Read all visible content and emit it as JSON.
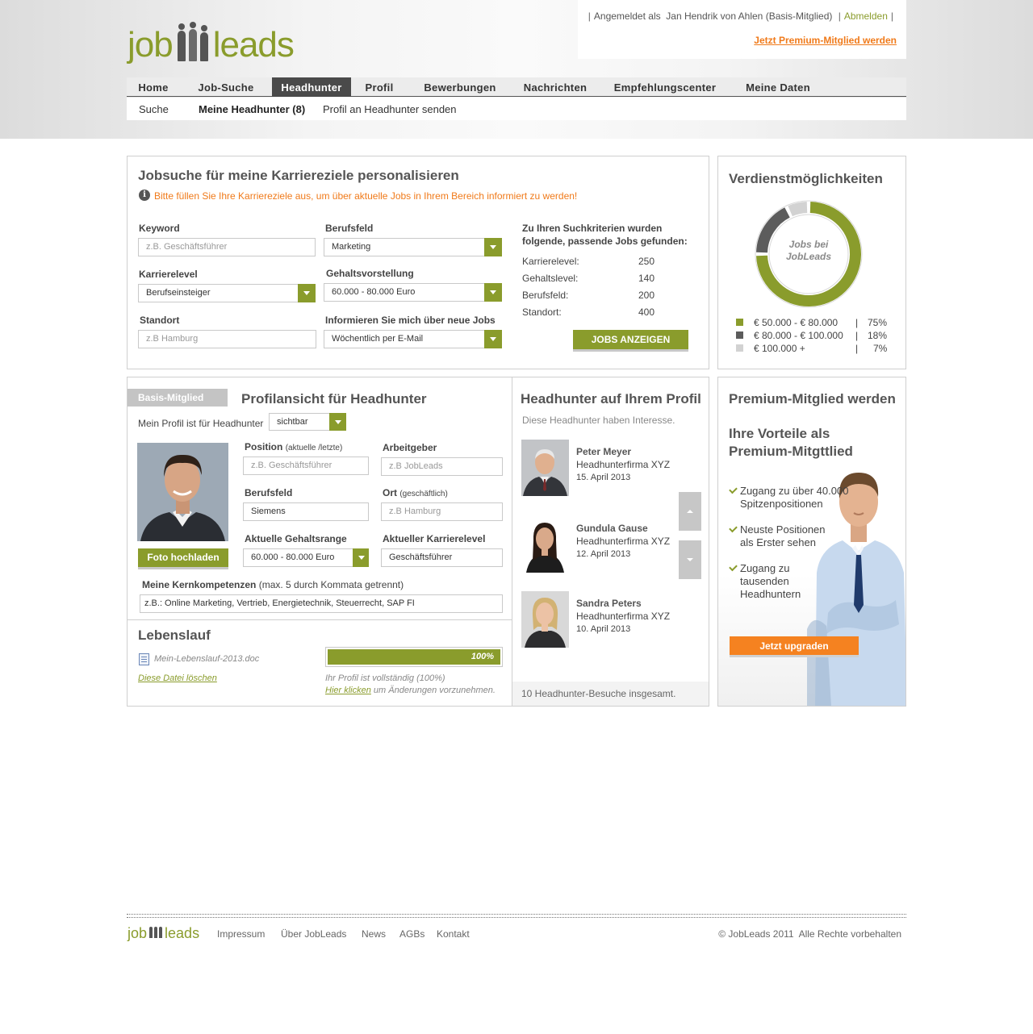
{
  "logo": {
    "part1": "job",
    "part2": "leads"
  },
  "user": {
    "prefix": "Angemeldet als",
    "name": "Jan Hendrik von Ahlen (Basis-Mitglied)",
    "logout": "Abmelden",
    "premium_link": "Jetzt Premium-Mitglied werden"
  },
  "nav": {
    "items": [
      "Home",
      "Job-Suche",
      "Headhunter",
      "Profil",
      "Bewerbungen",
      "Nachrichten",
      "Empfehlungscenter",
      "Meine Daten"
    ],
    "active": "Headhunter"
  },
  "subnav": {
    "items": [
      "Suche",
      "Meine Headhunter (8)",
      "Profil an Headhunter senden"
    ]
  },
  "jobsearch": {
    "title": "Jobsuche für meine Karriereziele personalisieren",
    "notice": "Bitte füllen Sie Ihre Karriereziele aus, um über aktuelle Jobs in Ihrem Bereich informiert zu werden!",
    "keyword_label": "Keyword",
    "keyword_placeholder": "z.B. Geschäftsführer",
    "berufsfeld_label": "Berufsfeld",
    "berufsfeld_value": "Marketing",
    "karrierelevel_label": "Karrierelevel",
    "karrierelevel_value": "Berufseinsteiger",
    "gehalt_label": "Gehaltsvorstellung",
    "gehalt_value": "60.000 - 80.000 Euro",
    "standort_label": "Standort",
    "standort_placeholder": "z.B Hamburg",
    "inform_label": "Informieren Sie mich über neue Jobs",
    "inform_value": "Wöchentlich per E-Mail",
    "results_title_1": "Zu Ihren Suchkriterien wurden",
    "results_title_2": "folgende, passende Jobs gefunden:",
    "results": [
      {
        "label": "Karrierelevel:",
        "value": "250"
      },
      {
        "label": "Gehaltslevel:",
        "value": "140"
      },
      {
        "label": "Berufsfeld:",
        "value": "200"
      },
      {
        "label": "Standort:",
        "value": "400"
      }
    ],
    "button": "JOBS ANZEIGEN"
  },
  "earnings": {
    "title": "Verdienstmöglichkeiten",
    "center_1": "Jobs bei",
    "center_2": "JobLeads",
    "legend": [
      {
        "range": "€ 50.000 - € 80.000",
        "sep": "|",
        "pct": "75%",
        "value": 75,
        "color": "#8a9c2c"
      },
      {
        "range": "€ 80.000 - € 100.000",
        "sep": "|",
        "pct": "18%",
        "value": 18,
        "color": "#5c5c5c"
      },
      {
        "range": "€ 100.000 +",
        "sep": "|",
        "pct": "7%",
        "value": 7,
        "color": "#d2d2d2"
      }
    ]
  },
  "profile": {
    "badge": "Basis-Mitglied",
    "title": "Profilansicht für Headhunter",
    "visibility_label": "Mein Profil ist für Headhunter",
    "visibility_value": "sichtbar",
    "photo_button": "Foto hochladen",
    "position_label": "Position",
    "position_note": "(aktuelle /letzte)",
    "position_placeholder": "z.B. Geschäftsführer",
    "arbeitgeber_label": "Arbeitgeber",
    "arbeitgeber_placeholder": "z.B JobLeads",
    "berufsfeld_label": "Berufsfeld",
    "berufsfeld_value": "Siemens",
    "ort_label": "Ort",
    "ort_note": "(geschäftlich)",
    "ort_placeholder": "z.B Hamburg",
    "gehalt_label": "Aktuelle Gehaltsrange",
    "gehalt_value": "60.000 - 80.000 Euro",
    "karriere_label": "Aktueller Karrierelevel",
    "karriere_value": "Geschäftsführer",
    "kern_label": "Meine Kernkompetenzen",
    "kern_note": "(max. 5 durch Kommata getrennt)",
    "kern_value": "z.B.: Online Marketing, Vertrieb, Energietechnik, Steuerrecht, SAP FI"
  },
  "cv": {
    "title": "Lebenslauf",
    "file": "Mein-Lebenslauf-2013.doc",
    "delete": "Diese Datei löschen",
    "progress_label": "100%",
    "progress": 100,
    "complete": "Ihr Profil ist vollständig (100%)",
    "click": "Hier klicken",
    "click_rest": "um Änderungen vorzunehmen."
  },
  "headhunters": {
    "title": "Headhunter auf Ihrem Profil",
    "subtitle": "Diese Headhunter haben Interesse.",
    "people": [
      {
        "name": "Peter Meyer",
        "firm": "Headhunterfirma XYZ",
        "date": "15. April 2013"
      },
      {
        "name": "Gundula Gause",
        "firm": "Headhunterfirma XYZ",
        "date": "12. April 2013"
      },
      {
        "name": "Sandra Peters",
        "firm": "Headhunterfirma XYZ",
        "date": "10. April 2013"
      }
    ],
    "footer": "10 Headhunter-Besuche insgesamt."
  },
  "premium": {
    "title": "Premium-Mitglied werden",
    "sub_1": "Ihre Vorteile als",
    "sub_2": "Premium-Mitgttlied",
    "benefits": [
      {
        "l1": "Zugang zu über 40.000",
        "l2": "Spitzenpositionen"
      },
      {
        "l1": "Neuste Positionen",
        "l2": "als Erster sehen"
      },
      {
        "l1": "Zugang zu",
        "l2": "tausenden",
        "l3": "Headhuntern"
      }
    ],
    "button": "Jetzt upgraden"
  },
  "footer": {
    "links": [
      "Impressum",
      "Über JobLeads",
      "News",
      "AGBs",
      "Kontakt"
    ],
    "copyright": "© JobLeads 2011  Alle Rechte vorbehalten"
  }
}
